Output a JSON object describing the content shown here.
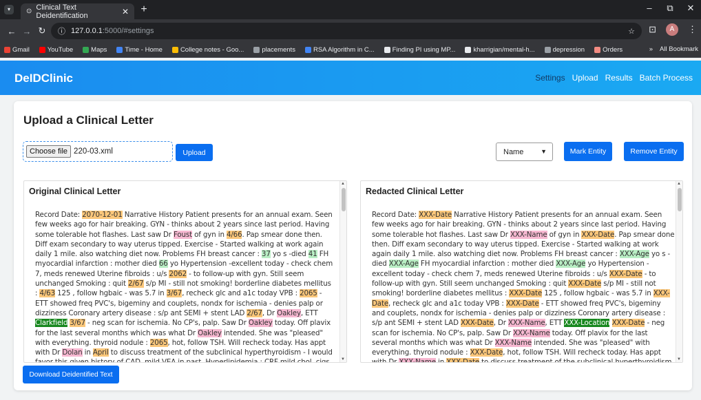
{
  "browser": {
    "tab_title": "Clinical Text Deidentification",
    "url_host": "127.0.0.1",
    "url_path": ":5000/#settings",
    "avatar": "A"
  },
  "bookmarks": [
    "Gmail",
    "YouTube",
    "Maps",
    "Time - Home",
    "College notes - Goo...",
    "placements",
    "RSA Algorithm in C...",
    "Finding PI using MP...",
    "kharrigian/mental-h...",
    "depression",
    "Orders"
  ],
  "bookmarks_all": "All Bookmark",
  "app": {
    "brand": "DeIDClinic",
    "nav": [
      "Settings",
      "Upload",
      "Results",
      "Batch Process"
    ]
  },
  "upload": {
    "heading": "Upload a Clinical Letter",
    "choose_label": "Choose file",
    "file_name": "220-03.xml",
    "upload_label": "Upload",
    "entity_type": "Name",
    "mark_label": "Mark Entity",
    "remove_label": "Remove Entity",
    "download_label": "Download Deidentified Text"
  },
  "original": {
    "title": "Original Clinical Letter",
    "segments": [
      [
        "Record Date: ",
        ""
      ],
      [
        "2070-12-01",
        "d"
      ],
      [
        " Narrative History Patient presents for an annual exam. Seen few weeks ago for hair breaking. GYN - thinks about 2 years since last period. Having some tolerable hot flashes. Last saw Dr ",
        ""
      ],
      [
        "Foust",
        "n"
      ],
      [
        " of gyn in ",
        ""
      ],
      [
        "4/66",
        "d"
      ],
      [
        ". Pap smear done then. Diff exam secondary to way uterus tipped. Exercise - Started walking at work again daily 1 mile. also watching diet now. Problems FH breast cancer : ",
        ""
      ],
      [
        "37",
        "a"
      ],
      [
        " yo s -died ",
        ""
      ],
      [
        "41",
        "a"
      ],
      [
        " FH myocardial infarction : mother died ",
        ""
      ],
      [
        "66",
        "a"
      ],
      [
        " yo Hypertension -excellent today - check chem 7, meds renewed Uterine fibroids : u/s ",
        ""
      ],
      [
        "2062",
        "d"
      ],
      [
        " - to follow-up with gyn. Still seem unchanged Smoking : quit ",
        ""
      ],
      [
        "2/67",
        "d"
      ],
      [
        " s/p MI - still not smoking! borderline diabetes mellitus : ",
        ""
      ],
      [
        "4/63",
        "d"
      ],
      [
        " 125 , follow hgbaic - was 5.7 in ",
        ""
      ],
      [
        "3/67",
        "d"
      ],
      [
        ", recheck glc and a1c today VPB : ",
        ""
      ],
      [
        "2065",
        "d"
      ],
      [
        " - ETT showed freq PVC's, bigeminy and couplets, nondx for ischemia - denies palp or dizziness Coronary artery disease : s/p ant SEMI + stent LAD ",
        ""
      ],
      [
        "2/67",
        "d"
      ],
      [
        ", Dr ",
        ""
      ],
      [
        "Oakley",
        "n"
      ],
      [
        ", ETT ",
        ""
      ],
      [
        "Clarkfield",
        "l"
      ],
      [
        " ",
        ""
      ],
      [
        "3/67",
        "d"
      ],
      [
        " - neg scan for ischemia. No CP's, palp. Saw Dr ",
        ""
      ],
      [
        "Oakley",
        "n"
      ],
      [
        " today. Off plavix for the last several months which was what Dr ",
        ""
      ],
      [
        "Oakley",
        "n"
      ],
      [
        " intended. She was \"pleased\" with everything. thyroid nodule : ",
        ""
      ],
      [
        "2065",
        "d"
      ],
      [
        ", hot, follow TSH. Will recheck today. Has appt with Dr ",
        ""
      ],
      [
        "Dolan",
        "n"
      ],
      [
        " in ",
        ""
      ],
      [
        "April",
        "d"
      ],
      [
        " to discuss treatment of the subclinical hyperthyroidism - I would favor this given history of CAD, mild VEA in past. Hyperlipidemia : CRF mild chol, cigs, HTN, fhx and known hx CAD in pt. Check lfts and cholesterol today.",
        ""
      ]
    ]
  },
  "redacted": {
    "title": "Redacted Clinical Letter",
    "segments": [
      [
        "Record Date: ",
        ""
      ],
      [
        "XXX-Date",
        "d"
      ],
      [
        " Narrative History Patient presents for an annual exam. Seen few weeks ago for hair breaking. GYN - thinks about 2 years since last period. Having some tolerable hot flashes. Last saw Dr ",
        ""
      ],
      [
        "XXX-Name",
        "n"
      ],
      [
        " of gyn in ",
        ""
      ],
      [
        "XXX-Date",
        "d"
      ],
      [
        ". Pap smear done then. Diff exam secondary to way uterus tipped. Exercise - Started walking at work again daily 1 mile. also watching diet now. Problems FH breast cancer : ",
        ""
      ],
      [
        "XXX-Age",
        "a"
      ],
      [
        " yo s -died ",
        ""
      ],
      [
        "XXX-Age",
        "a"
      ],
      [
        " FH myocardial infarction : mother died ",
        ""
      ],
      [
        "XXX-Age",
        "a"
      ],
      [
        " yo Hypertension -excellent today - check chem 7, meds renewed Uterine fibroids : u/s ",
        ""
      ],
      [
        "XXX-Date",
        "d"
      ],
      [
        " - to follow-up with gyn. Still seem unchanged Smoking : quit ",
        ""
      ],
      [
        "XXX-Date",
        "d"
      ],
      [
        " s/p MI - still not smoking! borderline diabetes mellitus : ",
        ""
      ],
      [
        "XXX-Date",
        "d"
      ],
      [
        " 125 , follow hgbaic - was 5.7 in ",
        ""
      ],
      [
        "XXX-Date",
        "d"
      ],
      [
        ", recheck glc and a1c today VPB : ",
        ""
      ],
      [
        "XXX-Date",
        "d"
      ],
      [
        " - ETT showed freq PVC's, bigeminy and couplets, nondx for ischemia - denies palp or dizziness Coronary artery disease : s/p ant SEMI + stent LAD ",
        ""
      ],
      [
        "XXX-Date",
        "d"
      ],
      [
        ", Dr ",
        ""
      ],
      [
        "XXX-Name",
        "n"
      ],
      [
        ", ETT ",
        ""
      ],
      [
        "XXX-Location",
        "l"
      ],
      [
        " ",
        ""
      ],
      [
        "XXX-Date",
        "d"
      ],
      [
        " - neg scan for ischemia. No CP's, palp. Saw Dr ",
        ""
      ],
      [
        "XXX-Name",
        "n"
      ],
      [
        " today. Off plavix for the last several months which was what Dr ",
        ""
      ],
      [
        "XXX-Name",
        "n"
      ],
      [
        " intended. She was \"pleased\" with everything. thyroid nodule : ",
        ""
      ],
      [
        "XXX-Date",
        "d"
      ],
      [
        ", hot, follow TSH. Will recheck today. Has appt with Dr ",
        ""
      ],
      [
        "XXX-Name",
        "n"
      ],
      [
        " in ",
        ""
      ],
      [
        "XXX-Date",
        "d"
      ],
      [
        " to discuss treatment of the subclinical hyperthyroidism - I would favor this given history of CAD, mild VEA in past. Hyperlipidemia : CRF mild chol, cigs, HTN,",
        ""
      ]
    ]
  },
  "colors": {
    "date": "#fbc77a",
    "name": "#f7b8d1",
    "age": "#b9eec4",
    "location": "#18881f",
    "accent": "#0a6ef0"
  }
}
